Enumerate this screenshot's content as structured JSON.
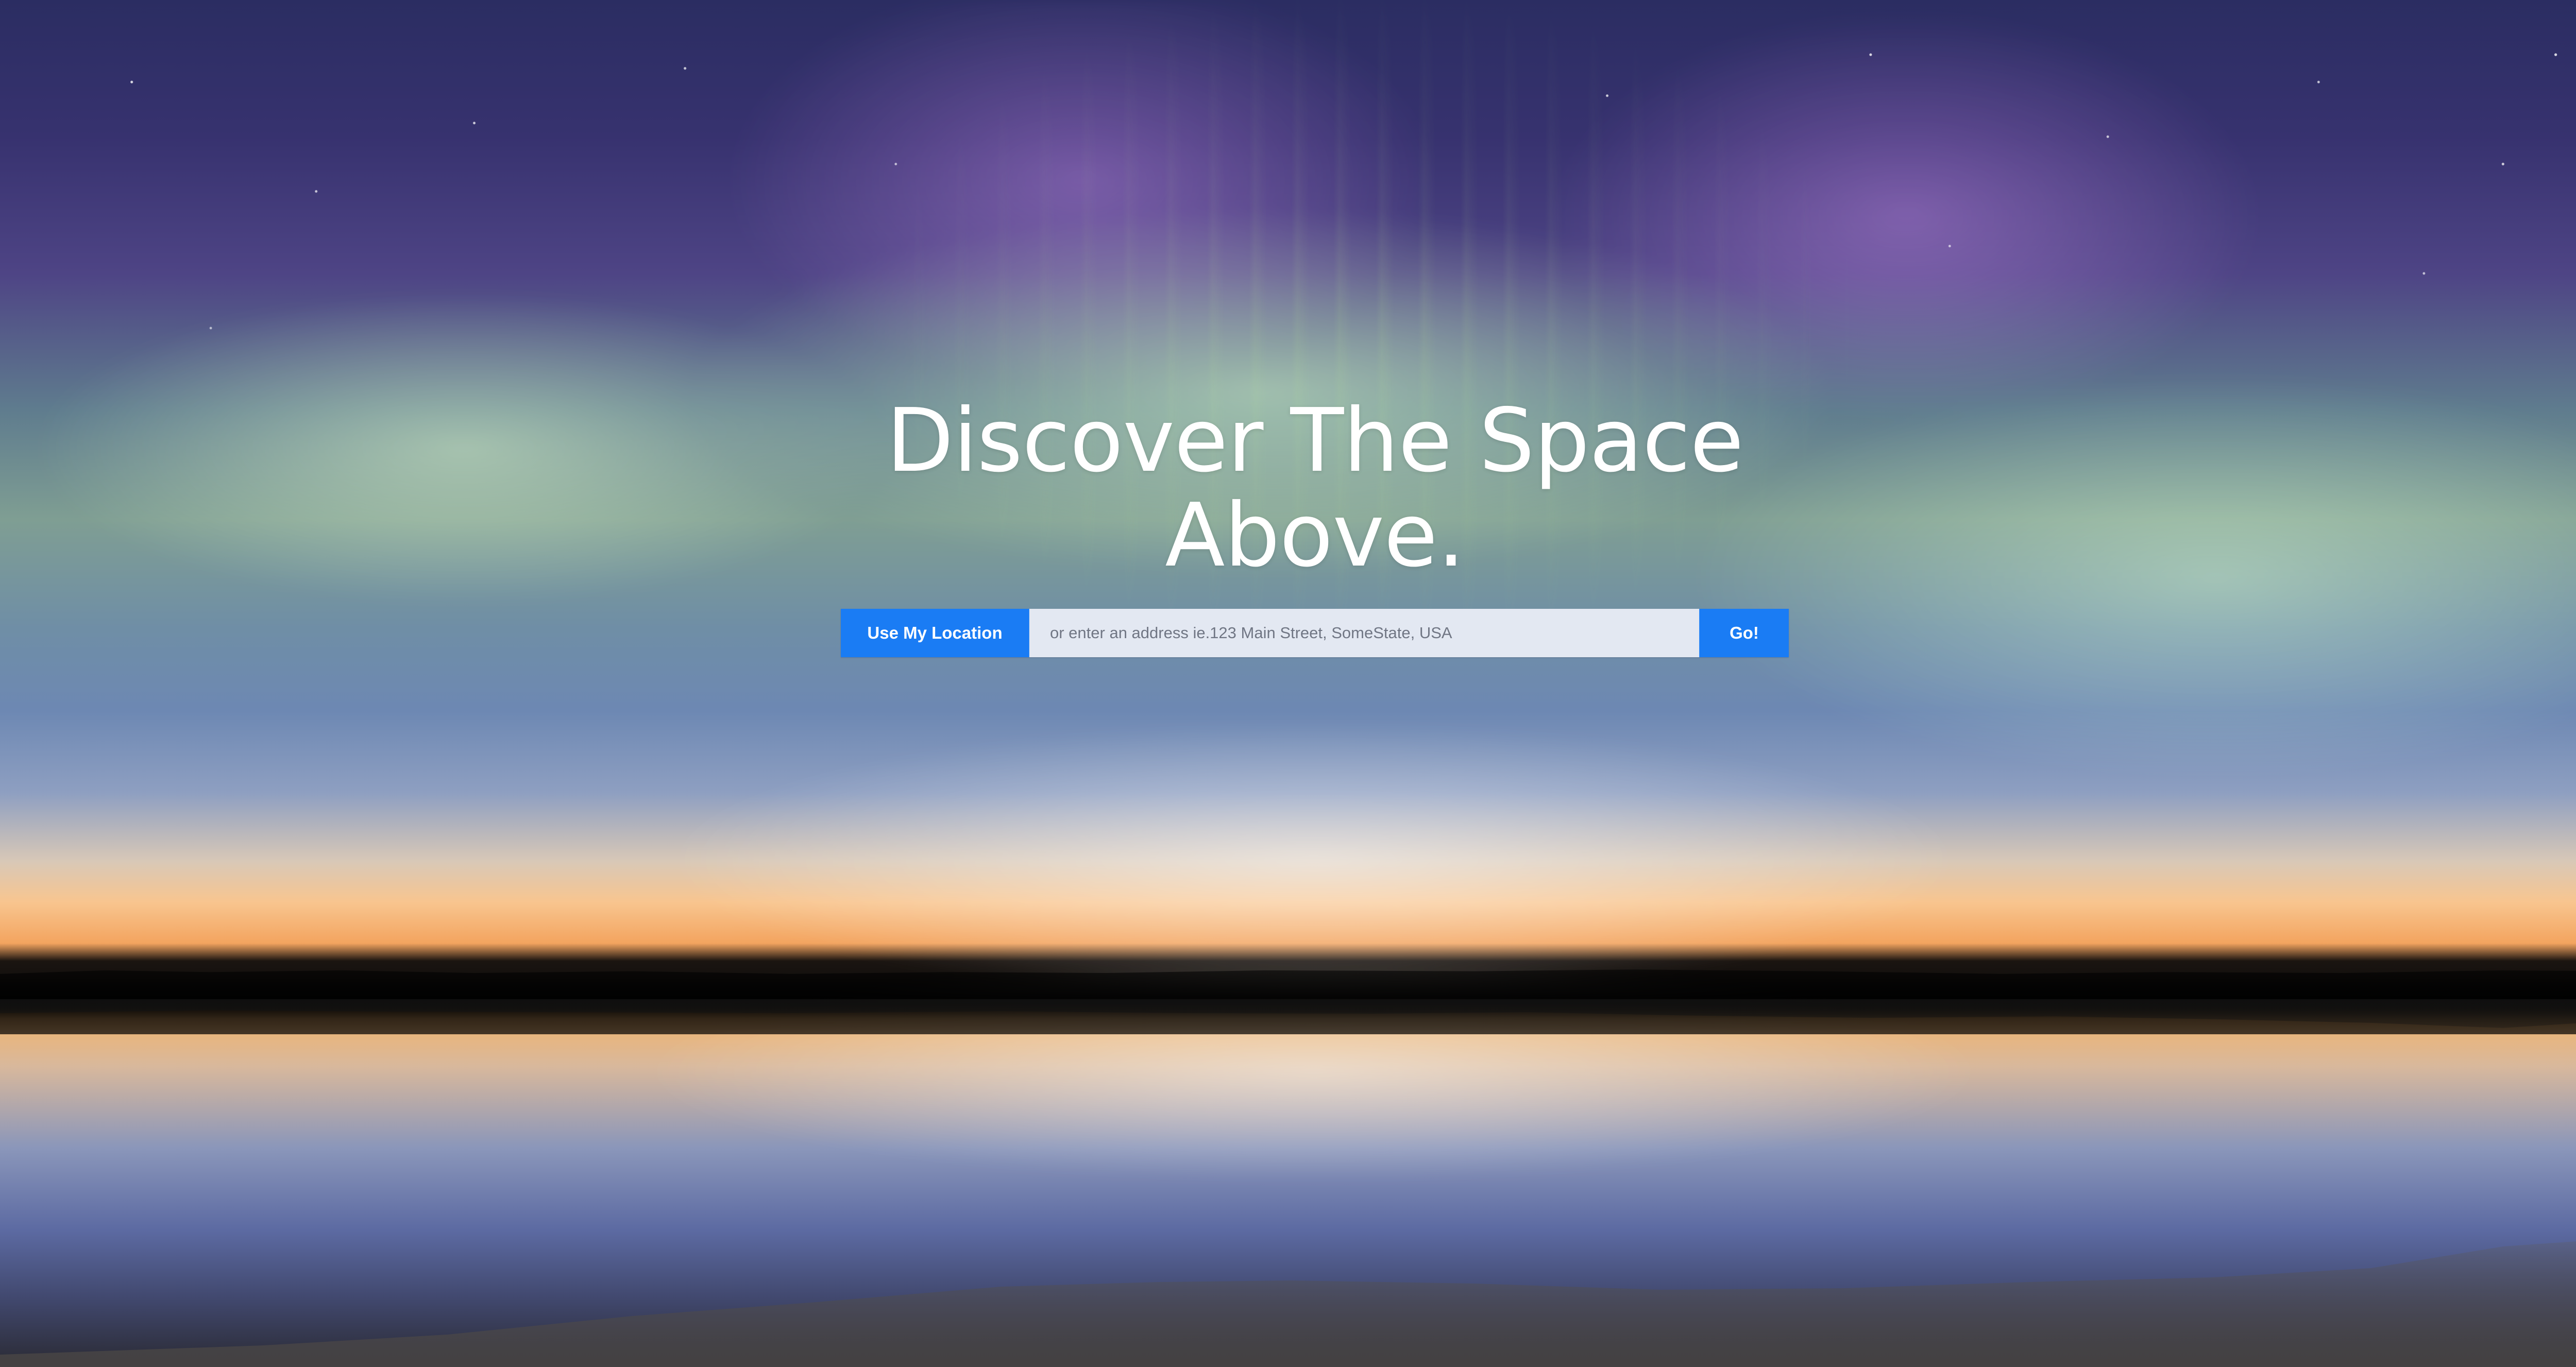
{
  "hero": {
    "headline": "Discover The Space Above."
  },
  "search": {
    "use_location_label": "Use My Location",
    "address_placeholder": "or enter an address ie.123 Main Street, SomeState, USA",
    "address_value": "",
    "go_label": "Go!"
  },
  "colors": {
    "button_primary": "#1a7cf4",
    "input_background": "#edf0f8",
    "headline_text": "#ffffff"
  }
}
